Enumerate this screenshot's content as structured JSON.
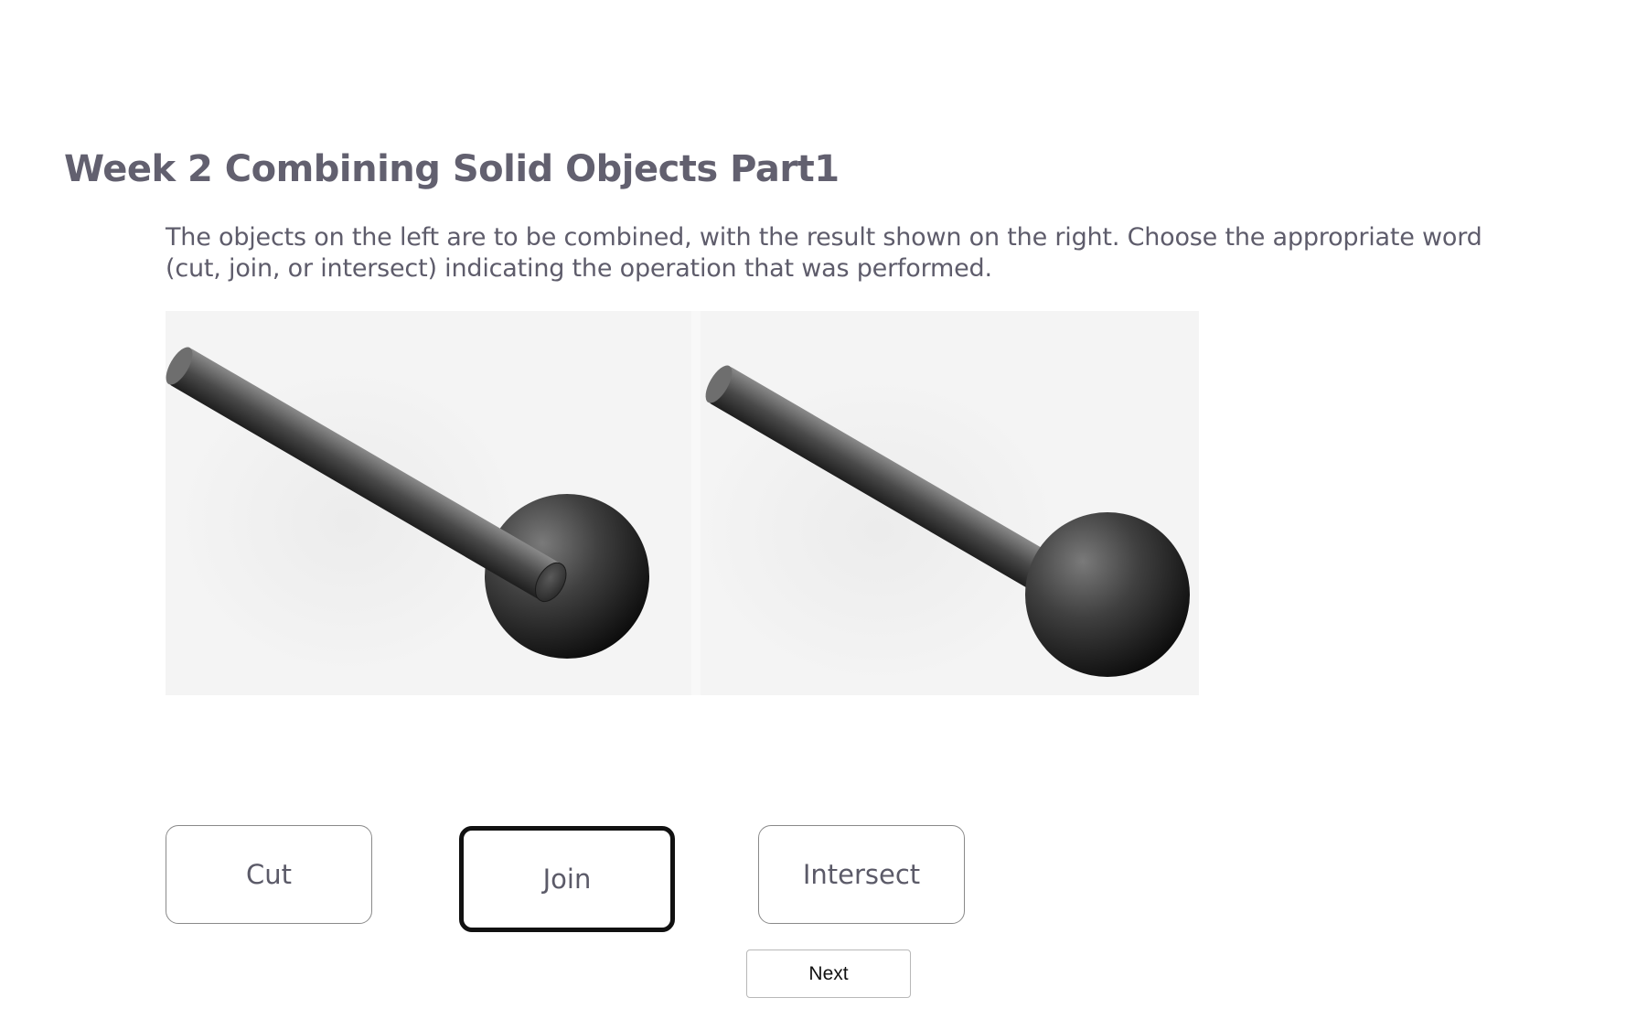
{
  "page": {
    "title": "Week 2 Combining Solid Objects Part1",
    "instructions": "The objects on the left are to be combined, with the result shown on the right. Choose the appropriate word (cut, join, or intersect) indicating the operation that was performed."
  },
  "figure": {
    "left_object": "rod-and-sphere-separate",
    "right_object": "rod-and-sphere-joined"
  },
  "choices": [
    {
      "label": "Cut",
      "selected": false
    },
    {
      "label": "Join",
      "selected": true
    },
    {
      "label": "Intersect",
      "selected": false
    }
  ],
  "next_button": {
    "label": "Next"
  },
  "colors": {
    "title": "#62606f",
    "text": "#5e5c6b",
    "selected_border": "#111111"
  }
}
